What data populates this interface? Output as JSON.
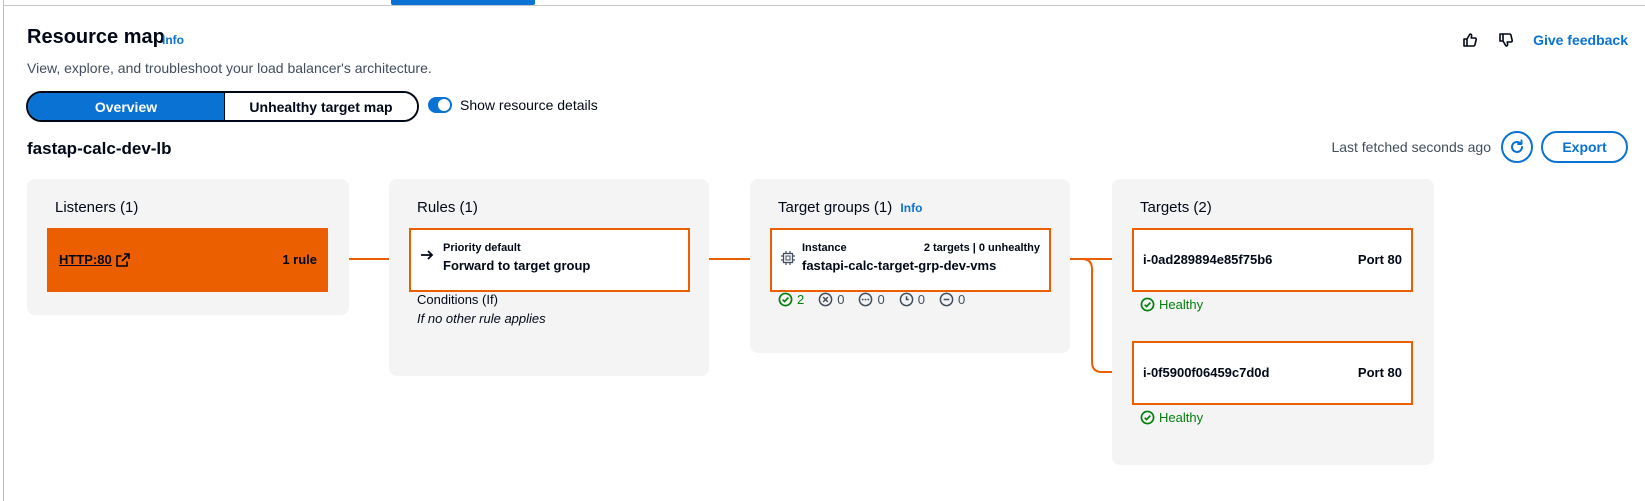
{
  "header": {
    "title": "Resource map",
    "info_label": "Info",
    "subtitle": "View, explore, and troubleshoot your load balancer's architecture.",
    "feedback_label": "Give feedback"
  },
  "view_toggle": {
    "options": [
      "Overview",
      "Unhealthy target map"
    ],
    "selected": "Overview"
  },
  "show_details": {
    "label": "Show resource details",
    "enabled": true
  },
  "load_balancer": {
    "name": "fastap-calc-dev-lb",
    "last_fetched": "Last fetched seconds ago",
    "export_label": "Export"
  },
  "listeners": {
    "title": "Listeners (1)",
    "items": [
      {
        "label": "HTTP:80",
        "rules": "1 rule"
      }
    ]
  },
  "rules": {
    "title": "Rules (1)",
    "items": [
      {
        "priority": "Priority default",
        "action": "Forward to target group"
      }
    ],
    "conditions_title": "Conditions (If)",
    "conditions_text": "If no other rule applies"
  },
  "target_groups": {
    "title": "Target groups (1)",
    "info_label": "Info",
    "items": [
      {
        "type": "Instance",
        "summary": "2 targets | 0 unhealthy",
        "name": "fastapi-calc-target-grp-dev-vms",
        "status_counts": {
          "healthy": "2",
          "unhealthy": "0",
          "initial": "0",
          "draining": "0",
          "unused": "0"
        }
      }
    ]
  },
  "targets": {
    "title": "Targets (2)",
    "items": [
      {
        "id": "i-0ad289894e85f75b6",
        "port": "Port 80",
        "health": "Healthy"
      },
      {
        "id": "i-0f5900f06459c7d0d",
        "port": "Port 80",
        "health": "Healthy"
      }
    ]
  },
  "colors": {
    "accent": "#0972d3",
    "node_border": "#ec5f00",
    "healthy": "#037f0c",
    "panel_bg": "#f4f4f5"
  }
}
